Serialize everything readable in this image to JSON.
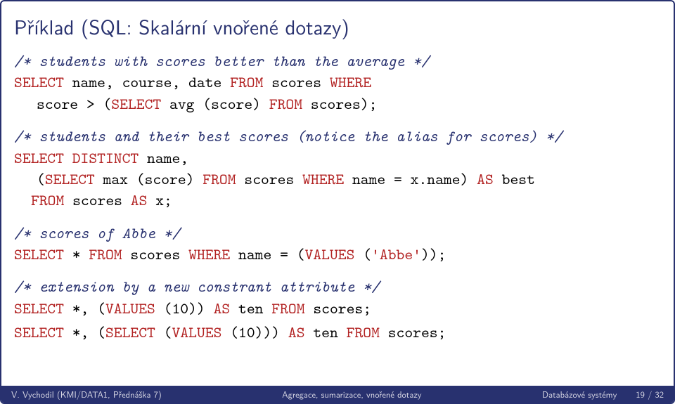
{
  "title": "Příklad (SQL: Skalární vnořené dotazy)",
  "code": {
    "c1": "/* students with scores better than the average */",
    "l1a": "SELECT",
    "l1b": " name, course, date ",
    "l1c": "FROM",
    "l1d": " scores ",
    "l1e": "WHERE",
    "l2a": "score > (",
    "l2b": "SELECT",
    "l2c": " avg (score) ",
    "l2d": "FROM",
    "l2e": " scores);",
    "c2": "/* students and their best scores (notice the alias for scores) */",
    "l3a": "SELECT DISTINCT",
    "l3b": " name,",
    "l4a": "(",
    "l4b": "SELECT",
    "l4c": " max (score) ",
    "l4d": "FROM",
    "l4e": " scores ",
    "l4f": "WHERE",
    "l4g": " name = x.name) ",
    "l4h": "AS",
    "l4i": " best",
    "l5a": "FROM",
    "l5b": " scores ",
    "l5c": "AS",
    "l5d": " x;",
    "c3": "/* scores of Abbe */",
    "l6a": "SELECT",
    "l6b": " * ",
    "l6c": "FROM",
    "l6d": " scores ",
    "l6e": "WHERE",
    "l6f": " name = (",
    "l6g": "VALUES",
    "l6h": " (",
    "l6i": "'Abbe'",
    "l6j": "));",
    "c4": "/* extension by a new constrant attribute */",
    "l7a": "SELECT",
    "l7b": " *, (",
    "l7c": "VALUES",
    "l7d": " (10)) ",
    "l7e": "AS",
    "l7f": " ten ",
    "l7g": "FROM",
    "l7h": " scores;",
    "l8a": "SELECT",
    "l8b": " *, (",
    "l8c": "SELECT",
    "l8d": " (",
    "l8e": "VALUES",
    "l8f": " (10))) ",
    "l8g": "AS",
    "l8h": " ten ",
    "l8i": "FROM",
    "l8j": " scores;"
  },
  "footer": {
    "left": "V. Vychodil (KMI/DATA1, Přednáška 7)",
    "center": "Agregace, sumarizace, vnořené dotazy",
    "right_label": "Databázové systémy",
    "right_page": "19 / 32"
  }
}
